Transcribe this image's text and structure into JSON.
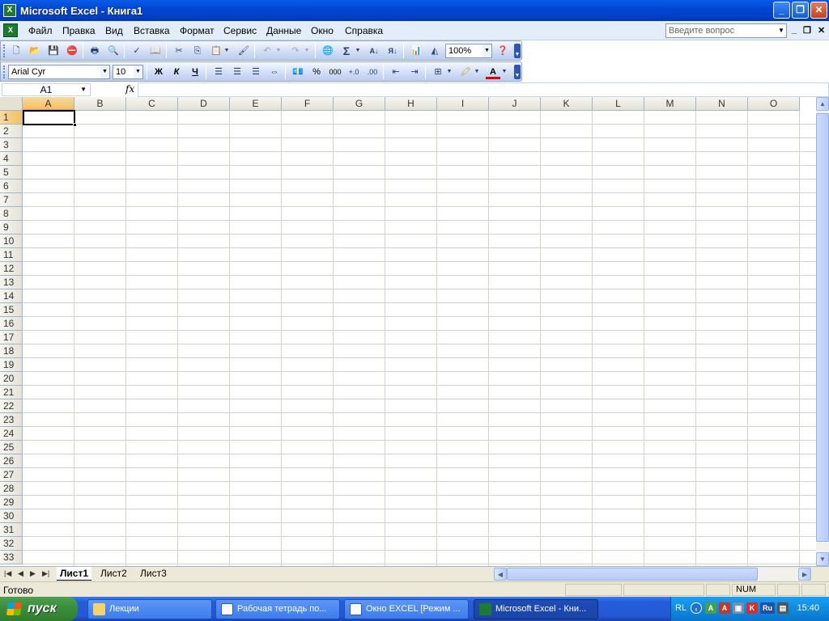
{
  "window": {
    "title": "Microsoft Excel - Книга1",
    "app_icon": "excel-icon"
  },
  "menu": {
    "items": [
      "Файл",
      "Правка",
      "Вид",
      "Вставка",
      "Формат",
      "Сервис",
      "Данные",
      "Окно",
      "Справка"
    ],
    "ask_placeholder": "Введите вопрос"
  },
  "standard_toolbar": {
    "zoom": "100%"
  },
  "formatting_toolbar": {
    "font": "Arial Cyr",
    "size": "10",
    "bold": "Ж",
    "italic": "К",
    "underline": "Ч",
    "percent": "%",
    "thousands": "000"
  },
  "formula_bar": {
    "name_box": "A1",
    "fx": "fx",
    "value": ""
  },
  "grid": {
    "columns": [
      "A",
      "B",
      "C",
      "D",
      "E",
      "F",
      "G",
      "H",
      "I",
      "J",
      "K",
      "L",
      "M",
      "N",
      "O"
    ],
    "rows": [
      "1",
      "2",
      "3",
      "4",
      "5",
      "6",
      "7",
      "8",
      "9",
      "10",
      "11",
      "12",
      "13",
      "14",
      "15",
      "16",
      "17",
      "18",
      "19",
      "20",
      "21",
      "22",
      "23",
      "24",
      "25",
      "26",
      "27",
      "28",
      "29",
      "30",
      "31",
      "32",
      "33"
    ],
    "active_cell": "A1"
  },
  "sheets": {
    "tabs": [
      "Лист1",
      "Лист2",
      "Лист3"
    ],
    "active": "Лист1"
  },
  "status": {
    "text": "Готово",
    "num": "NUM"
  },
  "taskbar": {
    "start": "пуск",
    "tasks": [
      "Лекции",
      "Рабочая тетрадь по...",
      "Окно EXCEL [Режим ...",
      "Microsoft Excel - Кни..."
    ],
    "active_task": "Microsoft Excel - Кни...",
    "tray_lang": "RL",
    "tray_ru": "Ru",
    "clock": "15:40"
  },
  "colors": {
    "title_bar": "#0046d5",
    "menu_bg": "#e3ecf9",
    "selected_header": "#f1c05e",
    "taskbar": "#245edb",
    "start_button": "#3c8f3c"
  }
}
